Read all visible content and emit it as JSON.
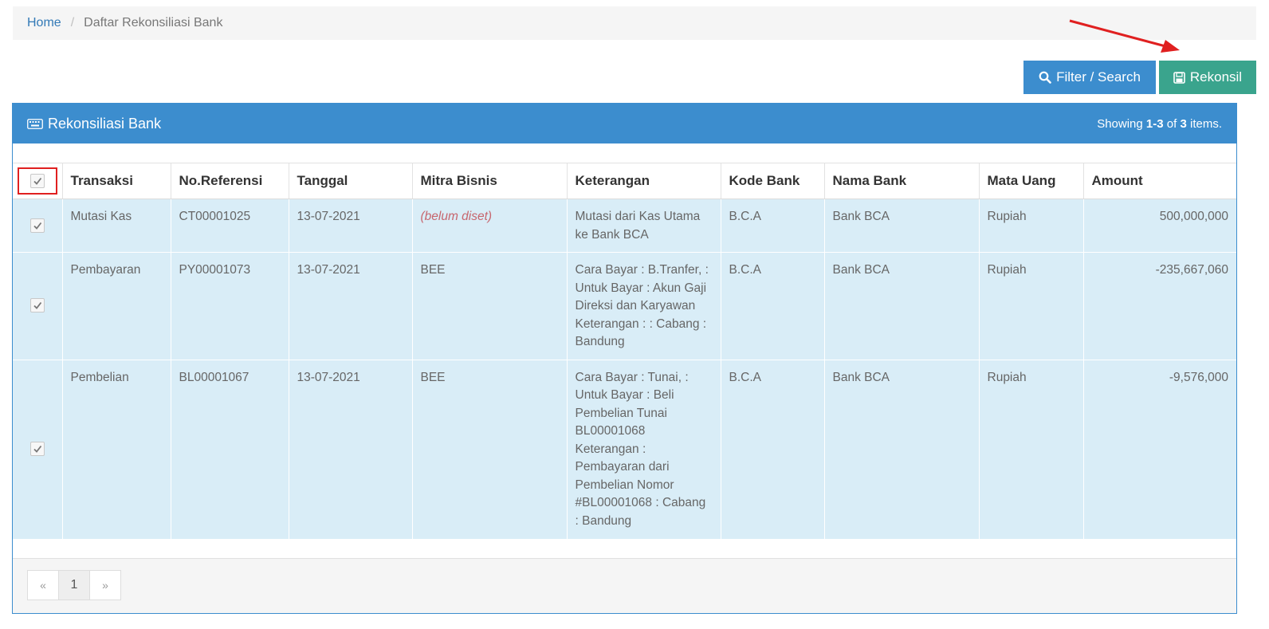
{
  "breadcrumb": {
    "home": "Home",
    "separator": "/",
    "current": "Daftar Rekonsiliasi Bank"
  },
  "toolbar": {
    "filter_label": "Filter / Search",
    "rekonsil_label": "Rekonsil"
  },
  "panel": {
    "title": "Rekonsiliasi Bank",
    "summary_prefix": "Showing ",
    "summary_range": "1-3",
    "summary_of": " of ",
    "summary_total": "3",
    "summary_suffix": " items."
  },
  "table": {
    "headers": [
      "Transaksi",
      "No.Referensi",
      "Tanggal",
      "Mitra Bisnis",
      "Keterangan",
      "Kode Bank",
      "Nama Bank",
      "Mata Uang",
      "Amount"
    ],
    "rows": [
      {
        "transaksi": "Mutasi Kas",
        "ref": "CT00001025",
        "tanggal": "13-07-2021",
        "mitra": "(belum diset)",
        "keterangan": "Mutasi dari Kas Utama ke Bank BCA",
        "kode": "B.C.A",
        "nama": "Bank BCA",
        "mata": "Rupiah",
        "amount": "500,000,000"
      },
      {
        "transaksi": "Pembayaran",
        "ref": "PY00001073",
        "tanggal": "13-07-2021",
        "mitra": "BEE",
        "keterangan": "Cara Bayar : B.Tranfer, : Untuk Bayar : Akun Gaji Direksi dan Karyawan Keterangan : : Cabang : Bandung",
        "kode": "B.C.A",
        "nama": "Bank BCA",
        "mata": "Rupiah",
        "amount": "-235,667,060"
      },
      {
        "transaksi": "Pembelian",
        "ref": "BL00001067",
        "tanggal": "13-07-2021",
        "mitra": "BEE",
        "keterangan": "Cara Bayar : Tunai, : Untuk Bayar : Beli Pembelian Tunai BL00001068 Keterangan : Pembayaran dari Pembelian Nomor #BL00001068 : Cabang : Bandung",
        "kode": "B.C.A",
        "nama": "Bank BCA",
        "mata": "Rupiah",
        "amount": "-9,576,000"
      }
    ]
  },
  "pagination": {
    "prev": "«",
    "page": "1",
    "next": "»"
  },
  "icons": {
    "filter": "search-icon",
    "rekonsil": "save-icon",
    "panel": "keyboard-icon",
    "checkbox": "check-icon",
    "annotation": "red-arrow-icon"
  },
  "colors": {
    "primary": "#3c8dce",
    "success": "#3aa48d",
    "row_bg": "#d9edf7",
    "highlight": "#e02020"
  }
}
